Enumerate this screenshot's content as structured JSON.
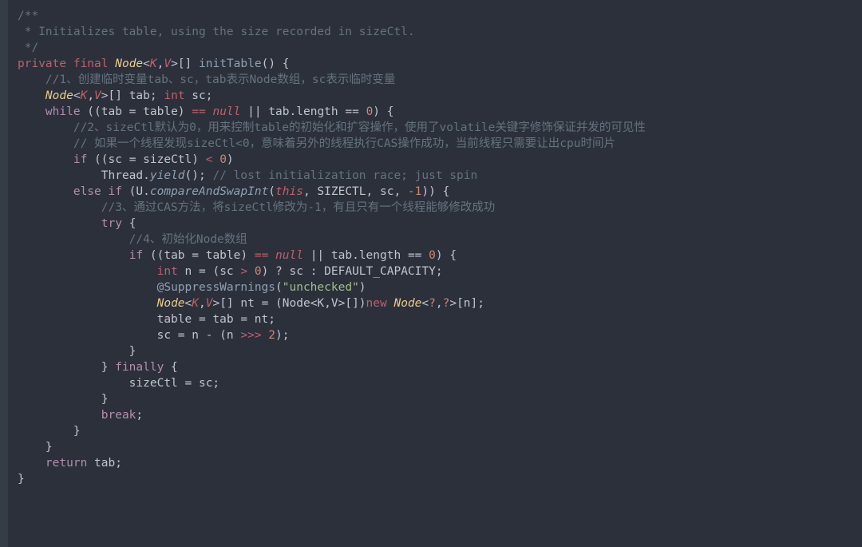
{
  "code": {
    "l1": "/**",
    "l2": " * Initializes table, using the size recorded in sizeCtl.",
    "l3": " */",
    "l4_private": "private",
    "l4_final": "final",
    "l4_node": "Node",
    "l4_lt": "<",
    "l4_K": "K",
    "l4_comma": ",",
    "l4_V": "V",
    "l4_gt": ">",
    "l4_arr": "[]",
    "l4_fn": "initTable",
    "l4_tail": "() {",
    "l5": "    //1、创建临时变量tab、sc，tab表示Node数组，sc表示临时变量",
    "l6_node": "Node",
    "l6_mid": "[] tab; ",
    "l6_int": "int",
    "l6_tail": " sc;",
    "l7_while": "while",
    "l7_a": " ((tab = table) ",
    "l7_eq": "==",
    "l7_sp": " ",
    "l7_null": "null",
    "l7_or": " || ",
    "l7_b": "tab",
    "l7_dot": ".",
    "l7_len": "length",
    "l7_c": " == ",
    "l7_zero": "0",
    "l7_tail": ") {",
    "l8": "        //2、sizeCtl默认为0，用来控制table的初始化和扩容操作，使用了volatile关键字修饰保证并发的可见性",
    "l9": "        // 如果一个线程发现sizeCtl<0，意味着另外的线程执行CAS操作成功，当前线程只需要让出cpu时间片",
    "l10_if": "if",
    "l10_a": " ((sc = sizeCtl) ",
    "l10_lt": "<",
    "l10_sp": " ",
    "l10_zero": "0",
    "l10_tail": ")",
    "l11_thread": "Thread",
    "l11_dot": ".",
    "l11_yield": "yield",
    "l11_tail": "(); ",
    "l11_cmt": "// lost initialization race; just spin",
    "l12_else": "else if",
    "l12_a": " (U",
    "l12_dot": ".",
    "l12_fn": "compareAndSwapInt",
    "l12_op": "(",
    "l12_this": "this",
    "l12_b": ", SIZECTL, sc, ",
    "l12_neg1": "-1",
    "l12_tail": ")) {",
    "l13": "            //3、通过CAS方法，将sizeCtl修改为-1，有且只有一个线程能够修改成功",
    "l14_try": "try",
    "l14_tail": " {",
    "l15": "                //4、初始化Node数组",
    "l16_if": "if",
    "l16_a": " ((tab = table) ",
    "l16_eq": "==",
    "l16_null": "null",
    "l16_or": " || ",
    "l16_tab": "tab",
    "l16_dot": ".",
    "l16_len": "length",
    "l16_eq2": " == ",
    "l16_zero": "0",
    "l16_tail": ") {",
    "l17_int": "int",
    "l17_a": " n = (sc ",
    "l17_gt": ">",
    "l17_sp": " ",
    "l17_zero": "0",
    "l17_b": ") ? sc : DEFAULT_CAPACITY;",
    "l18_at": "@",
    "l18_anno": "SuppressWarnings",
    "l18_op": "(",
    "l18_str": "\"unchecked\"",
    "l18_cp": ")",
    "l19_node1": "Node",
    "l19_a": "[] nt = (Node<K,V>[])",
    "l19_new": "new",
    "l19_sp": " ",
    "l19_node2": "Node",
    "l19_lt": "<",
    "l19_q1": "?",
    "l19_c": ",",
    "l19_q2": "?",
    "l19_gt": ">",
    "l19_tail": "[n];",
    "l20": "                    table = tab = nt;",
    "l21_a": "                    sc = n - (n ",
    "l21_shr": ">>>",
    "l21_sp": " ",
    "l21_two": "2",
    "l21_tail": ");",
    "l22": "                }",
    "l23_a": "            } ",
    "l23_finally": "finally",
    "l23_tail": " {",
    "l24": "                sizeCtl = sc;",
    "l25": "            }",
    "l26_break": "break",
    "l26_tail": ";",
    "l27": "        }",
    "l28": "    }",
    "l29_return": "return",
    "l29_tail": " tab;",
    "l30": "}"
  }
}
